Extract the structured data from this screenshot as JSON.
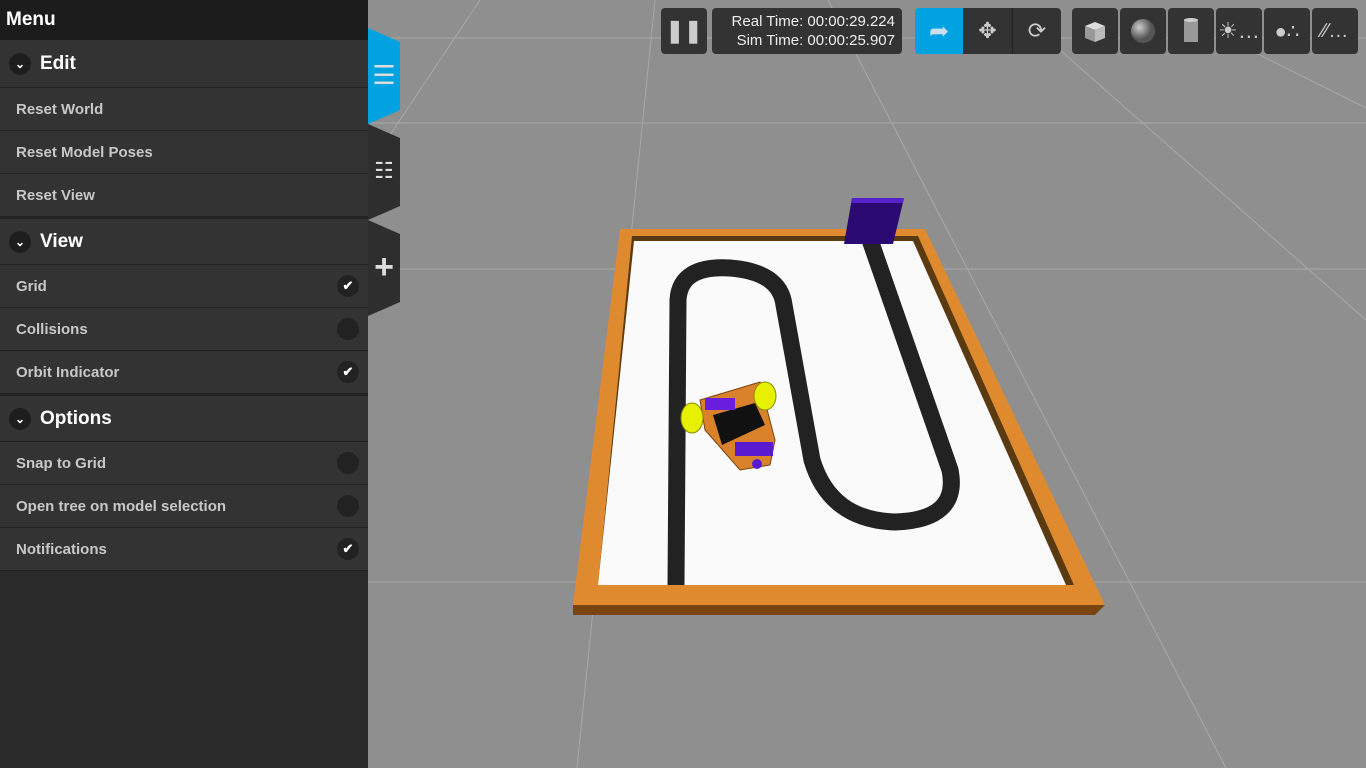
{
  "menu": {
    "title": "Menu",
    "sections": [
      {
        "label": "Edit",
        "items": [
          {
            "label": "Reset World"
          },
          {
            "label": "Reset Model Poses"
          },
          {
            "label": "Reset View"
          }
        ]
      },
      {
        "label": "View",
        "items": [
          {
            "label": "Grid",
            "checked": true
          },
          {
            "label": "Collisions",
            "checked": false
          },
          {
            "label": "Orbit Indicator",
            "checked": true
          }
        ]
      },
      {
        "label": "Options",
        "items": [
          {
            "label": "Snap to Grid",
            "checked": false
          },
          {
            "label": "Open tree on model selection",
            "checked": false
          },
          {
            "label": "Notifications",
            "checked": true
          }
        ]
      }
    ]
  },
  "tabs": [
    {
      "icon": "hamburger-icon",
      "active": true
    },
    {
      "icon": "tree-icon"
    },
    {
      "icon": "plus-icon"
    }
  ],
  "toolbar": {
    "real_time": "Real Time: 00:00:29.224",
    "sim_time": "Sim Time: 00:00:25.907",
    "modes": [
      "select",
      "translate",
      "rotate"
    ],
    "active_mode": "select",
    "insert": [
      "box",
      "sphere",
      "cylinder",
      "point-light",
      "spot-light",
      "directional-light"
    ]
  },
  "colors": {
    "accent": "#00a2e2",
    "panel": "#333333",
    "board": "#d9822b",
    "track": "#222222"
  }
}
